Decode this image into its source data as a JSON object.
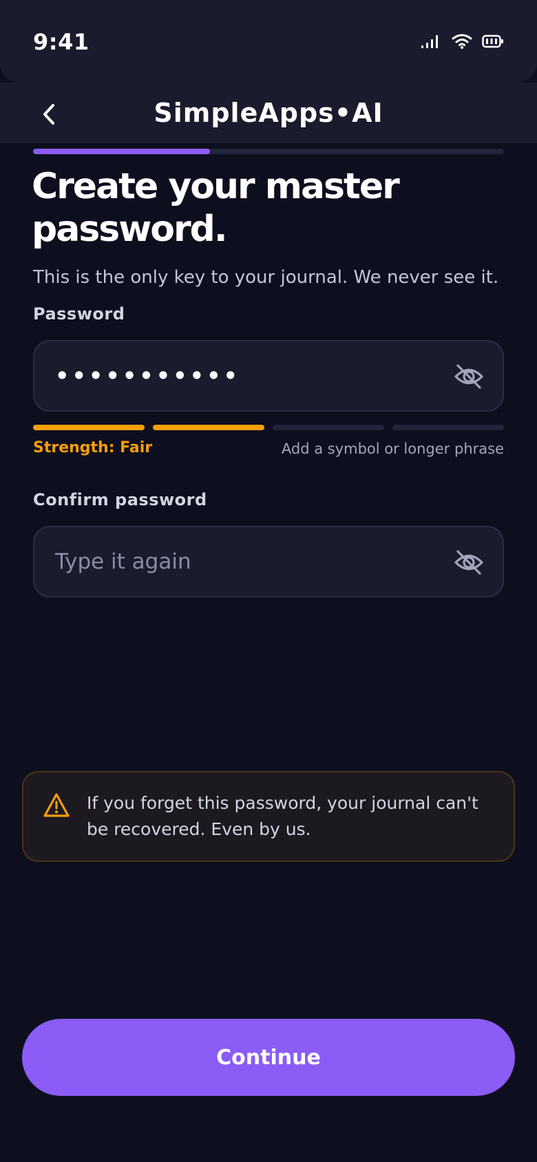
{
  "status_bar": {
    "time": "9:41",
    "icons": [
      "cellular-signal-icon",
      "wifi-icon",
      "battery-icon"
    ]
  },
  "nav": {
    "back_icon": "chevron-left-icon",
    "title": "SimpleApps•AI"
  },
  "progress": {
    "value": 0.375,
    "color": "#8b5cf6"
  },
  "headline": "Create your master password.",
  "subtitle": "This is the only key to your journal. We never see it.",
  "password_field": {
    "label": "Password",
    "value": "•••••••••••",
    "toggle_icon": "eye-off-icon"
  },
  "strength": {
    "segments_total": 4,
    "segments_filled": 2,
    "label": "Strength: Fair",
    "hint": "Add a symbol or longer phrase",
    "color": "#f59e0b"
  },
  "confirm_field": {
    "label": "Confirm password",
    "placeholder": "Type it again",
    "value": "",
    "toggle_icon": "eye-off-icon"
  },
  "warning": {
    "icon": "warning-triangle-icon",
    "text": "If you forget this password, your journal can't be recovered. Even by us."
  },
  "continue_label": "Continue",
  "colors": {
    "background": "#0e0f1e",
    "surface": "#1a1b2c",
    "accent": "#8b5cf6",
    "warning": "#f59e0b"
  }
}
